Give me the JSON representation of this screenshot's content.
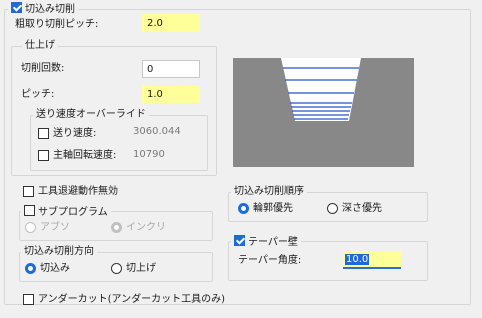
{
  "infeed": {
    "enabled": true,
    "title": "切込み切削",
    "rough_pitch_label": "粗取り切削ピッチ:",
    "rough_pitch_value": "2.0"
  },
  "finish": {
    "title": "仕上げ",
    "count_label": "切削回数:",
    "count_value": "0",
    "pitch_label": "ピッチ:",
    "pitch_value": "1.0",
    "override": {
      "title": "送り速度オーバーライド",
      "feed_label": "送り速度:",
      "feed_checked": false,
      "feed_value": "3060.044",
      "spindle_label": "主軸回転速度:",
      "spindle_checked": false,
      "spindle_value": "10790"
    }
  },
  "retract_disable": {
    "label": "工具退避動作無効",
    "checked": false
  },
  "subprogram": {
    "label": "サブプログラム",
    "checked": false,
    "abs_label": "アブソ",
    "inc_label": "インクリ",
    "selected": "インクリ"
  },
  "direction": {
    "title": "切込み切削方向",
    "cut_in_label": "切込み",
    "cut_up_label": "切上げ",
    "selected": "切込み"
  },
  "undercut": {
    "label": "アンダーカット(アンダーカット工具のみ)",
    "checked": false
  },
  "order": {
    "title": "切込み切削順序",
    "contour_label": "輪郭優先",
    "depth_label": "深さ優先",
    "selected": "輪郭優先"
  },
  "taper": {
    "label": "テーパー壁",
    "checked": true,
    "angle_label": "テーパー角度:",
    "angle_value": "10.0"
  },
  "colors": {
    "accent": "#1e6ad8",
    "highlight": "#ffff99",
    "preview_bg": "#888888"
  }
}
